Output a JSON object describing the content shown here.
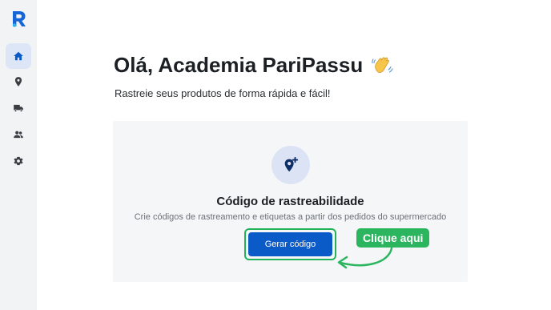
{
  "app": {
    "logo_letter": "R",
    "brand_color": "#1565d8"
  },
  "sidebar": {
    "items": [
      {
        "name": "home",
        "icon": "home-icon",
        "active": true
      },
      {
        "name": "location",
        "icon": "location-pin-icon",
        "active": false
      },
      {
        "name": "delivery",
        "icon": "truck-icon",
        "active": false
      },
      {
        "name": "users",
        "icon": "users-icon",
        "active": false
      },
      {
        "name": "settings",
        "icon": "gear-icon",
        "active": false
      }
    ]
  },
  "main": {
    "greeting": "Olá, Academia PariPassu",
    "greeting_emoji": "waving-hand",
    "subtitle": "Rastreie seus produtos de forma rápida e fácil!"
  },
  "card": {
    "icon": "location-pin-plus-icon",
    "title": "Código de rastreabilidade",
    "description": "Crie códigos de rastreamento e etiquetas a partir dos pedidos do supermercado",
    "button_label": "Gerar código",
    "button_color": "#0a5bc7"
  },
  "annotation": {
    "label": "Clique aqui",
    "color": "#2bb55e"
  }
}
